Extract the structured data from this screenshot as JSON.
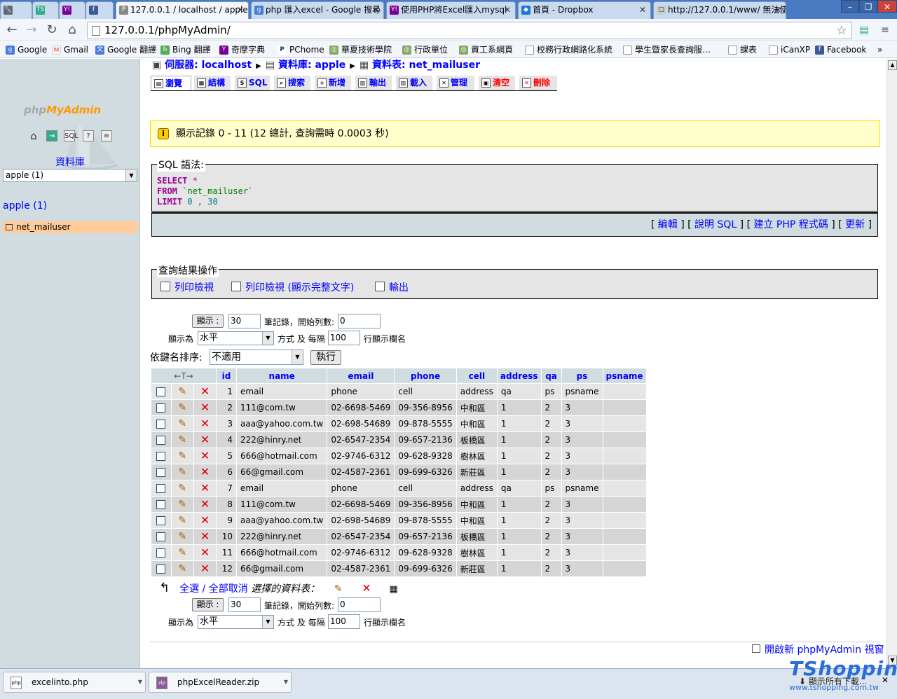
{
  "browser": {
    "tabs": [
      {
        "label": "",
        "icon": "wrench-icon"
      },
      {
        "label": "",
        "icon": "ts-icon"
      },
      {
        "label": "",
        "icon": "yahoo-icon"
      },
      {
        "label": "",
        "icon": "facebook-icon"
      },
      {
        "label": "127.0.0.1 / localhost / apple /",
        "icon": "pma-icon"
      },
      {
        "label": "php 匯入excel - Google 搜尋",
        "icon": "google-icon"
      },
      {
        "label": "使用PHP將Excel匯入mysql",
        "icon": "yahoo-icon"
      },
      {
        "label": "首頁 - Dropbox",
        "icon": "dropbox-icon"
      },
      {
        "label": "http://127.0.0.1/www/ 無法使",
        "icon": "page-icon"
      }
    ],
    "url": "127.0.0.1/phpMyAdmin/",
    "bookmarks": [
      "Google",
      "Gmail",
      "Google 翻譯",
      "Bing 翻譯",
      "奇摩字典",
      "PChome",
      "華夏技術學院",
      "行政單位",
      "資工系網頁",
      "校務行政網路化系統",
      "學生暨家長查詢服…",
      "課表",
      "iCanXP",
      "Facebook"
    ],
    "more_bookmarks": "»"
  },
  "sidebar": {
    "logo_php": "php",
    "logo_myadmin": "MyAdmin",
    "db_heading": "資料庫",
    "db_select": "apple (1)",
    "db_link": "apple (1)",
    "table_item": "net_mailuser",
    "icons": [
      "home-icon",
      "exit-icon",
      "sql-icon",
      "help-icon",
      "docs-icon"
    ]
  },
  "breadcrumb": {
    "server": "伺服器: localhost",
    "database": "資料庫: apple",
    "table": "資料表: net_mailuser"
  },
  "tabs": [
    {
      "label": "瀏覽",
      "icon": "browse-icon"
    },
    {
      "label": "結構",
      "icon": "structure-icon"
    },
    {
      "label": "SQL",
      "icon": "sql-icon"
    },
    {
      "label": "搜索",
      "icon": "search-icon"
    },
    {
      "label": "新增",
      "icon": "insert-icon"
    },
    {
      "label": "輸出",
      "icon": "export-icon"
    },
    {
      "label": "載入",
      "icon": "import-icon"
    },
    {
      "label": "管理",
      "icon": "operations-icon"
    },
    {
      "label": "清空",
      "icon": "empty-icon"
    },
    {
      "label": "刪除",
      "icon": "drop-icon"
    }
  ],
  "notice": "顯示記錄 0 - 11 (12 總計, 查詢需時 0.0003 秒)",
  "sql": {
    "legend": "SQL 語法:",
    "line1_kw": "SELECT",
    "line1_rest": " *",
    "line2_kw": "FROM",
    "line2_rest": " `net_mailuser`",
    "line3_kw": "LIMIT",
    "line3_rest": " 0 , 30",
    "actions": [
      "編輯",
      "說明 SQL",
      "建立 PHP 程式碼",
      "更新"
    ]
  },
  "query_ops": {
    "legend": "查詢結果操作",
    "items": [
      "列印檢視",
      "列印檢視 (顯示完整文字)",
      "輸出"
    ]
  },
  "nav": {
    "show_button": "顯示 :",
    "rows": "30",
    "rows_label": "筆記錄，開始列數:",
    "start": "0",
    "mode_label": "顯示為",
    "mode": "水平",
    "mode_label2": "方式 及 每隔",
    "repeat": "100",
    "repeat_label": "行顯示欄名"
  },
  "sort": {
    "label": "依鍵名排序:",
    "value": "不適用",
    "go": "執行"
  },
  "table": {
    "columns": [
      "id",
      "name",
      "email",
      "phone",
      "cell",
      "address",
      "qa",
      "ps",
      "psname"
    ],
    "rows": [
      [
        "1",
        "email",
        "phone",
        "cell",
        "address",
        "qa",
        "ps",
        "psname",
        ""
      ],
      [
        "2",
        "111@com.tw",
        "02-6698-5469",
        "09-356-8956",
        "中和區",
        "1",
        "2",
        "3",
        ""
      ],
      [
        "3",
        "aaa@yahoo.com.tw",
        "02-698-54689",
        "09-878-5555",
        "中和區",
        "1",
        "2",
        "3",
        ""
      ],
      [
        "4",
        "222@hinry.net",
        "02-6547-2354",
        "09-657-2136",
        "板橋區",
        "1",
        "2",
        "3",
        ""
      ],
      [
        "5",
        "666@hotmail.com",
        "02-9746-6312",
        "09-628-9328",
        "樹林區",
        "1",
        "2",
        "3",
        ""
      ],
      [
        "6",
        "66@gmail.com",
        "02-4587-2361",
        "09-699-6326",
        "新莊區",
        "1",
        "2",
        "3",
        ""
      ],
      [
        "7",
        "email",
        "phone",
        "cell",
        "address",
        "qa",
        "ps",
        "psname",
        ""
      ],
      [
        "8",
        "111@com.tw",
        "02-6698-5469",
        "09-356-8956",
        "中和區",
        "1",
        "2",
        "3",
        ""
      ],
      [
        "9",
        "aaa@yahoo.com.tw",
        "02-698-54689",
        "09-878-5555",
        "中和區",
        "1",
        "2",
        "3",
        ""
      ],
      [
        "10",
        "222@hinry.net",
        "02-6547-2354",
        "09-657-2136",
        "板橋區",
        "1",
        "2",
        "3",
        ""
      ],
      [
        "11",
        "666@hotmail.com",
        "02-9746-6312",
        "09-628-9328",
        "樹林區",
        "1",
        "2",
        "3",
        ""
      ],
      [
        "12",
        "66@gmail.com",
        "02-4587-2361",
        "09-699-6326",
        "新莊區",
        "1",
        "2",
        "3",
        ""
      ]
    ]
  },
  "bottom": {
    "check_all": "全選 / 全部取消",
    "with_selected": "選擇的資料表：",
    "new_window": "開啟新 phpMyAdmin 視窗"
  },
  "downloads": {
    "items": [
      "excelinto.php",
      "phpExcelReader.zip"
    ],
    "show_all": "顯示所有下載..."
  },
  "watermark": {
    "brand": "TShopping",
    "url": "www.tshopping.com.tw"
  },
  "colors": {
    "link": "#0000ff",
    "sidebar_bg": "#d0dce0",
    "notice_bg": "#ffffcc",
    "row_odd": "#e5e5e5",
    "row_even": "#d5d5d5",
    "table_highlight": "#ffcc99"
  }
}
